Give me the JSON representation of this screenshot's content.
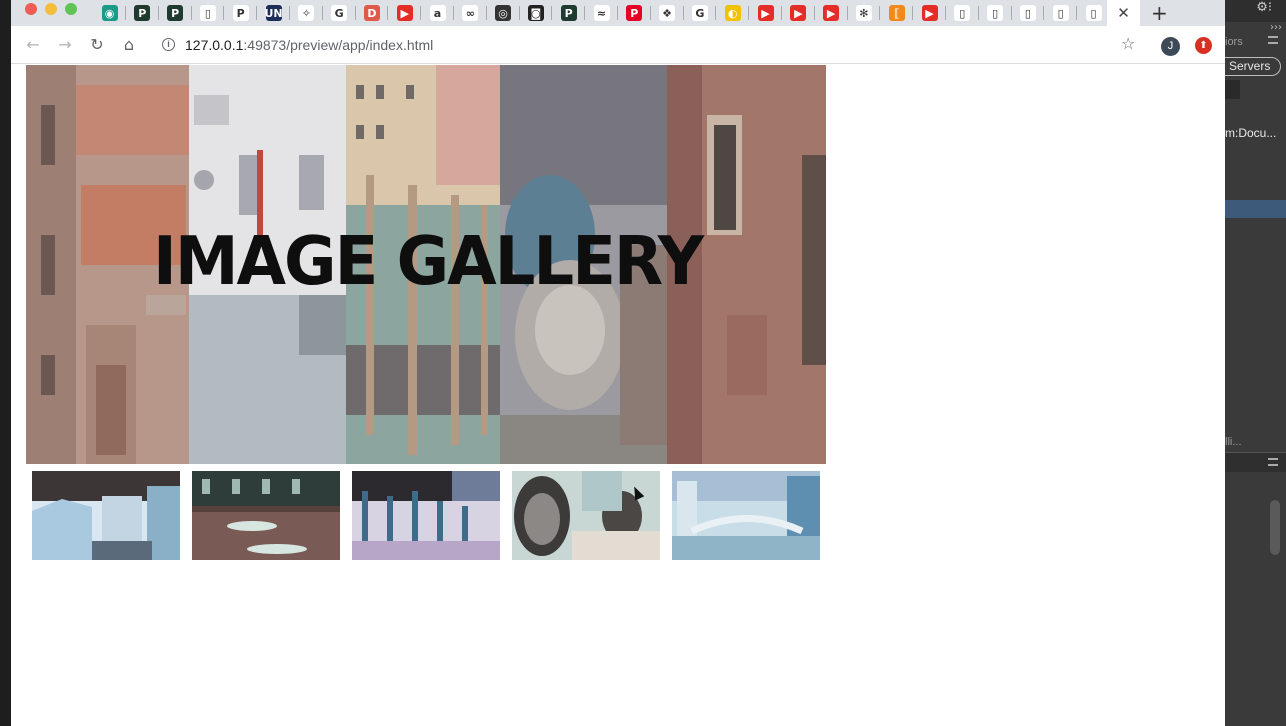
{
  "browser": {
    "tabs": [
      {
        "icon": "globe-icon",
        "color": "#1a9c8a",
        "glyph": "◉"
      },
      {
        "icon": "p-icon",
        "color": "#1f3b2f",
        "glyph": "P"
      },
      {
        "icon": "p-icon",
        "color": "#1f3b2f",
        "glyph": "P"
      },
      {
        "icon": "doc-icon",
        "color": "#ffffff",
        "glyph": "▯"
      },
      {
        "icon": "paypal-icon",
        "color": "#ffffff",
        "glyph": "P"
      },
      {
        "icon": "un-icon",
        "color": "#1c2d5a",
        "glyph": "UN"
      },
      {
        "icon": "app-icon",
        "color": "#ffffff",
        "glyph": "✧"
      },
      {
        "icon": "google-icon",
        "color": "#ffffff",
        "glyph": "G"
      },
      {
        "icon": "dtw-icon",
        "color": "#e05a4a",
        "glyph": "D"
      },
      {
        "icon": "youtube-icon",
        "color": "#e52d27",
        "glyph": "▶"
      },
      {
        "icon": "amazon-icon",
        "color": "#ffffff",
        "glyph": "a"
      },
      {
        "icon": "eztv-icon",
        "color": "#ffffff",
        "glyph": "∞"
      },
      {
        "icon": "chrome-dark-icon",
        "color": "#333333",
        "glyph": "◎"
      },
      {
        "icon": "instagram-icon",
        "color": "#222222",
        "glyph": "◙"
      },
      {
        "icon": "p-icon",
        "color": "#1f3b2f",
        "glyph": "P"
      },
      {
        "icon": "sr-icon",
        "color": "#ffffff",
        "glyph": "≈"
      },
      {
        "icon": "pinterest-icon",
        "color": "#e60023",
        "glyph": "P"
      },
      {
        "icon": "dropbox-icon",
        "color": "#ffffff",
        "glyph": "❖"
      },
      {
        "icon": "google-icon",
        "color": "#ffffff",
        "glyph": "G"
      },
      {
        "icon": "mask-icon",
        "color": "#f2c200",
        "glyph": "◐"
      },
      {
        "icon": "youtube-icon",
        "color": "#e52d27",
        "glyph": "▶"
      },
      {
        "icon": "youtube-icon",
        "color": "#e52d27",
        "glyph": "▶"
      },
      {
        "icon": "youtube-icon",
        "color": "#e52d27",
        "glyph": "▶"
      },
      {
        "icon": "pinwheel-icon",
        "color": "#ffffff",
        "glyph": "✻"
      },
      {
        "icon": "brackets-icon",
        "color": "#f18a1c",
        "glyph": "⟦"
      },
      {
        "icon": "youtube-icon",
        "color": "#e52d27",
        "glyph": "▶"
      },
      {
        "icon": "doc-icon",
        "color": "#ffffff",
        "glyph": "▯"
      },
      {
        "icon": "doc-icon",
        "color": "#ffffff",
        "glyph": "▯"
      },
      {
        "icon": "doc-icon",
        "color": "#ffffff",
        "glyph": "▯"
      },
      {
        "icon": "doc-icon",
        "color": "#ffffff",
        "glyph": "▯"
      },
      {
        "icon": "doc-icon",
        "color": "#ffffff",
        "glyph": "▯"
      }
    ],
    "active_tab_close": "✕",
    "new_tab": "+",
    "url_host": "127.0.0.1",
    "url_rest": ":49873/preview/app/index.html",
    "profile_initial": "J"
  },
  "page": {
    "title": "IMAGE GALLERY"
  },
  "editor": {
    "colors_label": "iors",
    "servers_label": "Servers",
    "doc_label": "m:Docu...",
    "ali_label": "lli..."
  }
}
